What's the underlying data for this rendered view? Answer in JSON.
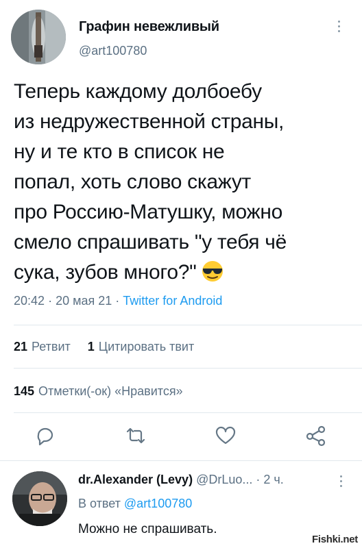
{
  "tweet": {
    "author_name": "Графин невежливый",
    "author_handle": "@art100780",
    "lines": [
      "Теперь каждому долбоебу",
      "из недружественной страны,",
      "ну и те кто в список не",
      "попал, хоть слово скажут",
      "про Россию-Матушку, можно",
      "смело спрашивать \"у тебя чё",
      "сука, зубов много?\""
    ],
    "emoji": "sunglasses-emoji",
    "time": "20:42",
    "date": "20 мая 21",
    "separator": "·",
    "source": "Twitter for Android"
  },
  "stats": {
    "retweets_count": "21",
    "retweets_label": "Ретвит",
    "quotes_count": "1",
    "quotes_label": "Цитировать твит",
    "likes_count": "145",
    "likes_label": "Отметки(-ок) «Нравится»"
  },
  "actions": [
    "reply-icon",
    "retweet-icon",
    "like-icon",
    "share-icon"
  ],
  "reply": {
    "author_name": "dr.Alexander (Levy)",
    "author_handle": "@DrLuo...",
    "age": "· 2 ч.",
    "in_reply_label": "В ответ",
    "in_reply_handle": "@art100780",
    "text": "Можно не спрашивать."
  },
  "watermark": "Fishki.net",
  "colors": {
    "text": "#0f1419",
    "secondary": "#5b7083",
    "link": "#1d9bf0",
    "divider": "#e1e8ed",
    "icon": "#657786"
  }
}
